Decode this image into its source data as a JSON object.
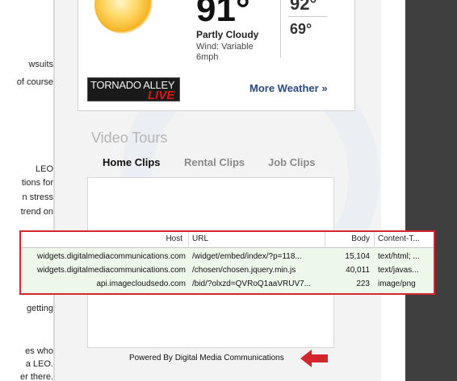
{
  "left_fragments": [
    {
      "text": "wsuits"
    },
    {
      "text": "of course"
    },
    {
      "text": "LEO"
    },
    {
      "text": "tions for"
    },
    {
      "text": "n stress"
    },
    {
      "text": "trend on"
    },
    {
      "text": "getting"
    },
    {
      "text": "es who"
    },
    {
      "text": "a LEO."
    },
    {
      "text": "er there."
    }
  ],
  "weather": {
    "temp": "91°",
    "condition": "Partly Cloudy",
    "wind": "Wind: Variable 6mph",
    "high": "92°",
    "low": "69°",
    "tornado_line1": "TORNADO ALLEY",
    "tornado_line2": "LIVE",
    "more_weather": "More Weather »"
  },
  "video_tours": {
    "title": "Video Tours",
    "tabs": [
      {
        "label": "Home Clips",
        "active": true
      },
      {
        "label": "Rental Clips",
        "active": false
      },
      {
        "label": "Job Clips",
        "active": false
      }
    ],
    "powered_by": "Powered By Digital Media Communications"
  },
  "network": {
    "columns": {
      "host": "Host",
      "url": "URL",
      "body": "Body",
      "content_type": "Content-T..."
    },
    "rows": [
      {
        "host": "widgets.digitalmediacommunications.com",
        "url": "/widget/embed/index/?p=118...",
        "body": "15,104",
        "content_type": "text/html; ..."
      },
      {
        "host": "widgets.digitalmediacommunications.com",
        "url": "/chosen/chosen.jquery.min.js",
        "body": "40,011",
        "content_type": "text/javas..."
      },
      {
        "host": "api.imageclouds​edo.com",
        "url": "/bid/?olxzd=QVRoQ1aaVRUV7...",
        "body": "223",
        "content_type": "image/png"
      }
    ]
  },
  "colors": {
    "accent_red": "#d3262d",
    "link_blue": "#2b4a7d",
    "panel_bg": "#eef8ea"
  }
}
